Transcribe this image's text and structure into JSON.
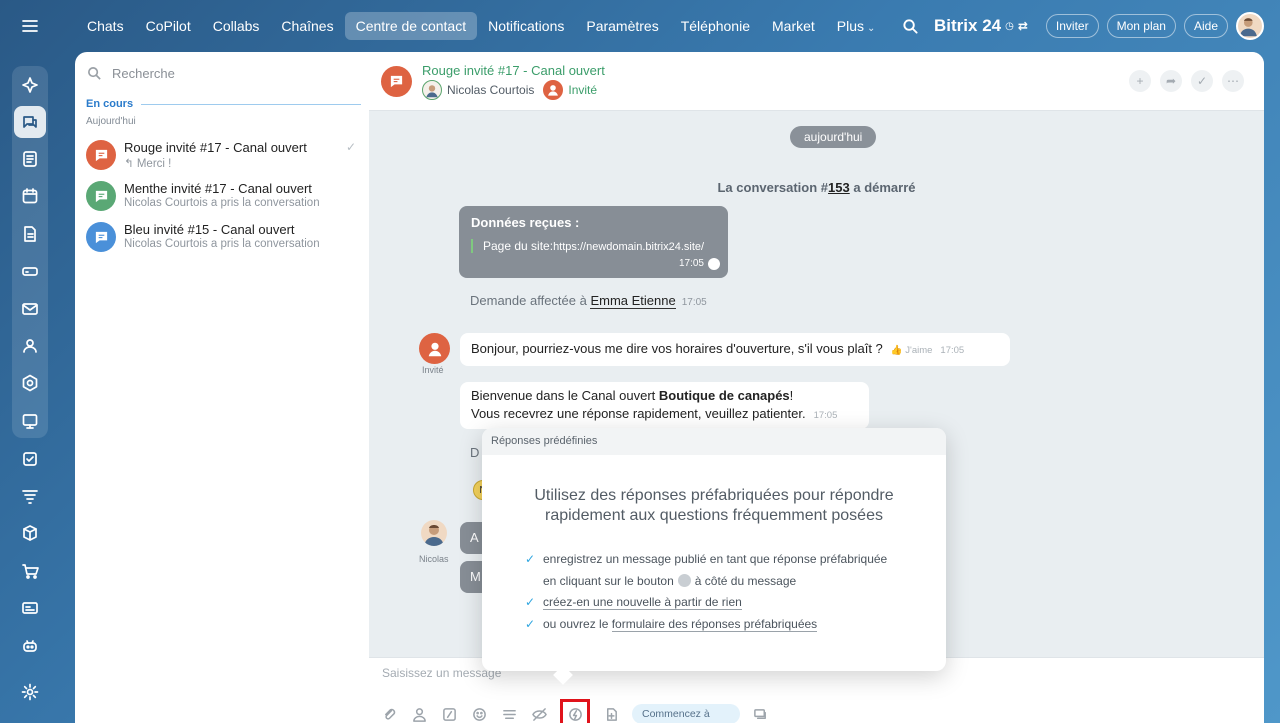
{
  "nav": {
    "items": [
      "Chats",
      "CoPilot",
      "Collabs",
      "Chaînes",
      "Centre de contact",
      "Notifications",
      "Paramètres",
      "Téléphonie",
      "Market",
      "Plus"
    ],
    "brand": "Bitrix 24",
    "invite": "Inviter",
    "plan": "Mon plan",
    "help": "Aide"
  },
  "list": {
    "search_placeholder": "Recherche",
    "section": "En cours",
    "sub": "Aujourd'hui",
    "chats": [
      {
        "title": "Rouge invité #17 - Canal ouvert",
        "subtitle": "Merci !",
        "color": "#de6342"
      },
      {
        "title": "Menthe invité #17 - Canal ouvert",
        "subtitle": "Nicolas Courtois a pris la conversation",
        "color": "#5aa875"
      },
      {
        "title": "Bleu invité #15 - Canal ouvert",
        "subtitle": "Nicolas Courtois a pris la conversation",
        "color": "#4a90d9"
      }
    ]
  },
  "header": {
    "title": "Rouge invité #17 - Canal ouvert",
    "operator": "Nicolas Courtois",
    "guest": "Invité"
  },
  "chat": {
    "date": "aujourd'hui",
    "conv_prefix": "La conversation #",
    "conv_num": "153",
    "conv_suffix": " a démarré",
    "data_title": "Données reçues :",
    "data_label": "Page du site:",
    "data_url": "https://newdomain.bitrix24.site/",
    "data_time": "17:05",
    "assign_text": "Demande affectée à ",
    "assign_name": "Emma Etienne",
    "assign_time": "17:05",
    "guest_name": "Invité",
    "msg1": "Bonjour, pourriez-vous me dire vos horaires d'ouverture, s'il vous plaît ?",
    "msg1_like": "J'aime",
    "msg1_time": "17:05",
    "msg2_a": "Bienvenue dans le Canal ouvert ",
    "msg2_b": "Boutique de canapés",
    "msg2_c": "!",
    "msg2_d": "Vous recevrez une réponse rapidement, veuillez patienter.",
    "msg2_time": "17:05",
    "cut_d": "D",
    "cut_icon": "N",
    "nico_name": "Nicolas",
    "gray1": "A",
    "gray2": "M"
  },
  "popup": {
    "header": "Réponses prédéfinies",
    "title_line1": "Utilisez des réponses préfabriquées pour répondre",
    "title_line2": "rapidement aux questions fréquemment posées",
    "item1": "enregistrez un message publié en tant que réponse préfabriquée",
    "item2a": "en cliquant sur le bouton",
    "item2b": "à côté du message",
    "item3": "créez-en une nouvelle à partir de rien",
    "item4a": "ou ouvrez le ",
    "item4b": "formulaire des réponses préfabriquées"
  },
  "composer": {
    "placeholder": "Saisissez un message",
    "start": "Commencez à"
  }
}
